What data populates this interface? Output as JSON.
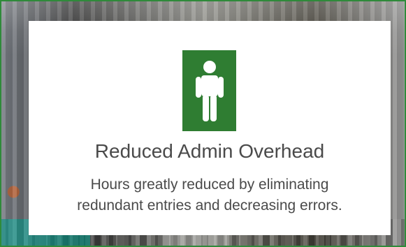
{
  "card": {
    "title": "Reduced Admin Overhead",
    "description_lines": [
      "Hours greatly reduced by eliminating",
      "redundant entries and decreasing errors."
    ],
    "icon": "person-icon"
  },
  "colors": {
    "accent_green": "#2f7d32",
    "frame_green": "#2f8a3a",
    "text_gray": "#4a4a4a"
  }
}
